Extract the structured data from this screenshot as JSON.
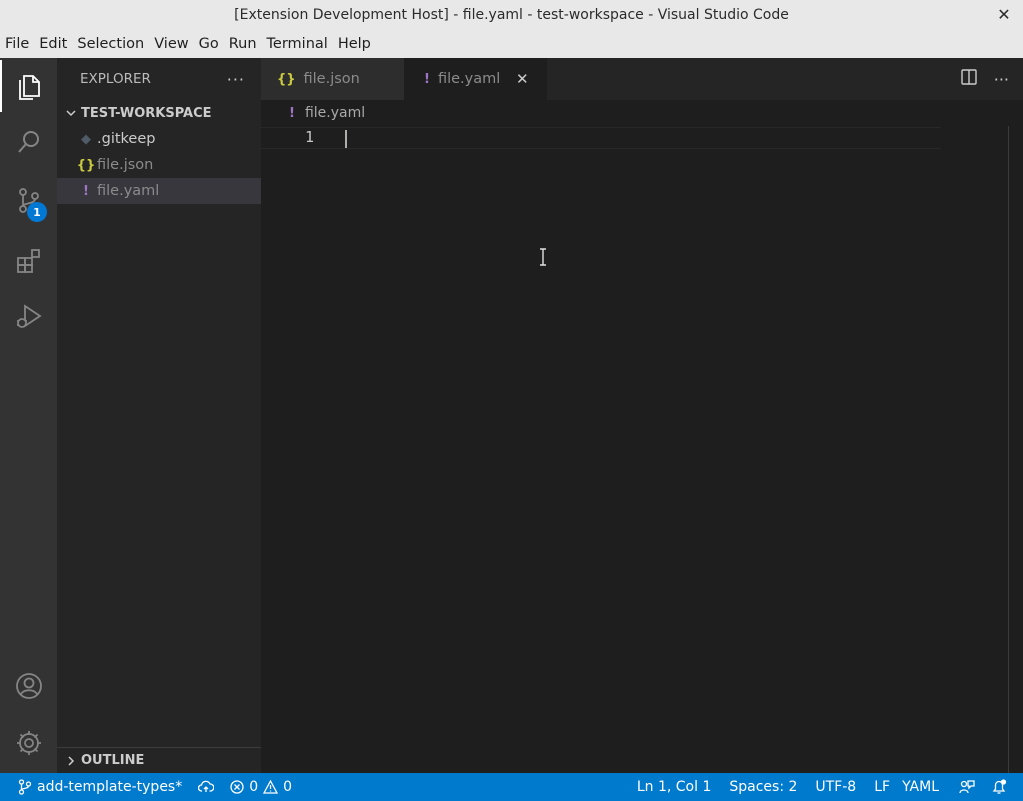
{
  "window": {
    "title": "[Extension Development Host] - file.yaml - test-workspace - Visual Studio Code",
    "close_glyph": "✕"
  },
  "menu": [
    "File",
    "Edit",
    "Selection",
    "View",
    "Go",
    "Run",
    "Terminal",
    "Help"
  ],
  "activity_bar": {
    "items": [
      {
        "name": "explorer-icon"
      },
      {
        "name": "search-icon"
      },
      {
        "name": "source-control-icon",
        "badge": "1"
      },
      {
        "name": "extensions-icon"
      },
      {
        "name": "run-debug-icon"
      }
    ],
    "bottom": [
      {
        "name": "account-icon"
      },
      {
        "name": "settings-gear-icon"
      }
    ]
  },
  "sidebar": {
    "title": "EXPLORER",
    "more": "···",
    "workspace": "TEST-WORKSPACE",
    "files": [
      {
        "name": ".gitkeep",
        "icon": "◆",
        "icon_color": "#4f5b66"
      },
      {
        "name": "file.json",
        "icon": "{}",
        "icon_color": "#cbcb41"
      },
      {
        "name": "file.yaml",
        "icon": "!",
        "icon_color": "#a074c4"
      }
    ],
    "outline": "OUTLINE"
  },
  "tabs": [
    {
      "label": "file.json",
      "icon": "{}",
      "icon_color": "#cbcb41"
    },
    {
      "label": "file.yaml",
      "icon": "!",
      "icon_color": "#a074c4",
      "close": "✕"
    }
  ],
  "tab_actions": {
    "more": "···"
  },
  "breadcrumb": {
    "icon": "!",
    "file": "file.yaml"
  },
  "editor": {
    "line_number": "1"
  },
  "statusbar": {
    "branch": "add-template-types*",
    "errors": "0",
    "warnings": "0",
    "position": "Ln 1, Col 1",
    "spaces": "Spaces: 2",
    "encoding": "UTF-8",
    "eol": "LF",
    "language": "YAML"
  },
  "colors": {
    "statusbar": "#007acc",
    "activity_bar": "#333333",
    "sidebar": "#252526",
    "editor": "#1e1e1e",
    "yaml_icon": "#a074c4",
    "json_icon": "#cbcb41"
  }
}
